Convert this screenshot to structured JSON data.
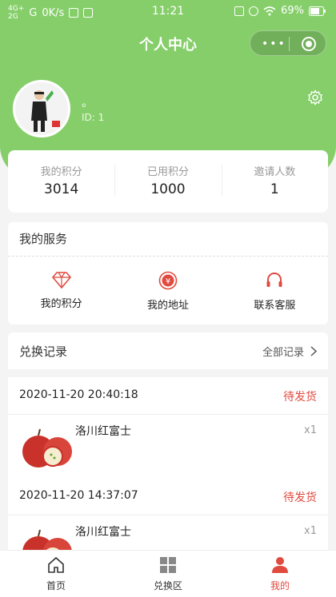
{
  "status_bar": {
    "network_top": "4G+",
    "network_bottom": "2G",
    "signal": "G",
    "speed": "0K/s",
    "time": "11:21",
    "battery": "69%"
  },
  "nav": {
    "title": "个人中心",
    "menu_icon": "more-dots-icon",
    "close_icon": "target-icon"
  },
  "profile": {
    "name": "。",
    "id_label": "ID: 1"
  },
  "stats": [
    {
      "label": "我的积分",
      "value": "3014"
    },
    {
      "label": "已用积分",
      "value": "1000"
    },
    {
      "label": "邀请人数",
      "value": "1"
    }
  ],
  "services": {
    "title": "我的服务",
    "items": [
      {
        "label": "我的积分",
        "icon": "diamond-icon"
      },
      {
        "label": "我的地址",
        "icon": "yuan-icon"
      },
      {
        "label": "联系客服",
        "icon": "headset-icon"
      }
    ]
  },
  "records": {
    "title": "兑换记录",
    "all_label": "全部记录"
  },
  "orders": [
    {
      "date": "2020-11-20 20:40:18",
      "status": "待发货",
      "product": "洛川红富士",
      "qty": "x1"
    },
    {
      "date": "2020-11-20 14:37:07",
      "status": "待发货",
      "product": "洛川红富士",
      "qty": "x1"
    }
  ],
  "tabbar": [
    {
      "label": "首页",
      "icon": "home-icon"
    },
    {
      "label": "兑换区",
      "icon": "grid-icon"
    },
    {
      "label": "我的",
      "icon": "user-icon"
    }
  ],
  "colors": {
    "brand_green": "#85ce6a",
    "accent_red": "#e04a3f"
  }
}
